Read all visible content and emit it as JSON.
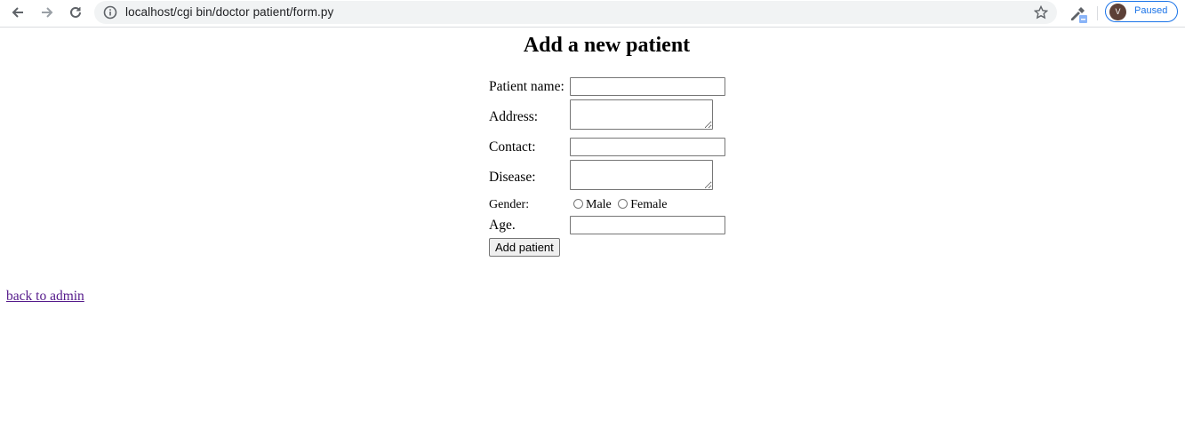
{
  "browser": {
    "url": "localhost/cgi bin/doctor patient/form.py",
    "profile_initial": "V",
    "profile_status": "Paused"
  },
  "page": {
    "title": "Add a new patient",
    "fields": {
      "patient_name_label": "Patient name:",
      "address_label": "Address:",
      "contact_label": "Contact:",
      "disease_label": "Disease:",
      "gender_label": "Gender:",
      "gender_options": [
        "Male",
        "Female"
      ],
      "age_label": "Age."
    },
    "submit_label": "Add patient",
    "back_link": "back to admin"
  }
}
